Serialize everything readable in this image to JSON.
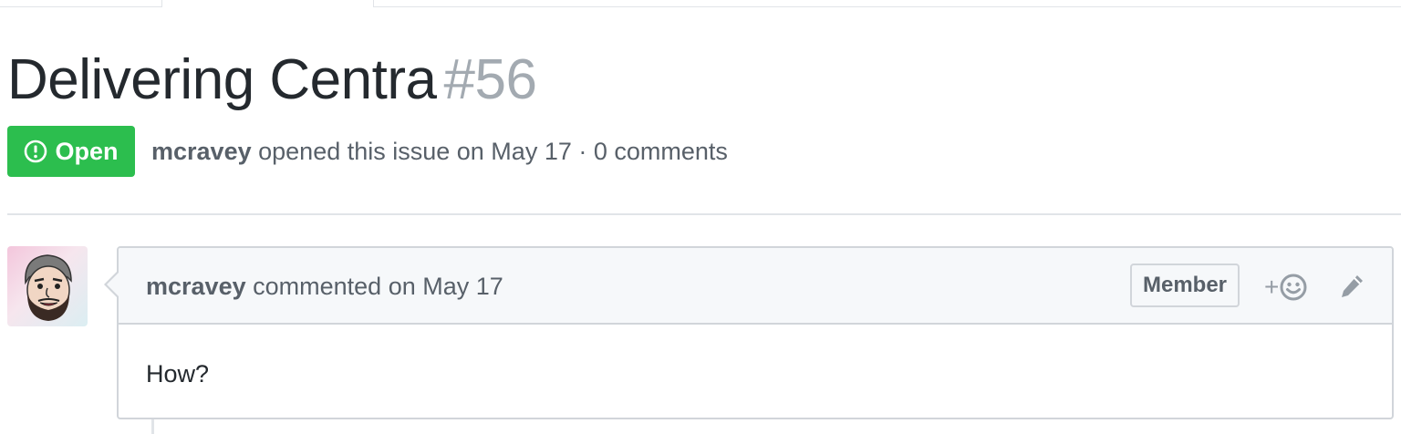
{
  "issue": {
    "title": "Delivering Centra",
    "number": "#56",
    "state_label": "Open",
    "state_icon": "issue-opened-icon",
    "author": "mcravey",
    "meta_text": "opened this issue on May 17 · 0 comments"
  },
  "comment": {
    "author": "mcravey",
    "action_text": "commented on May 17",
    "author_association": "Member",
    "reaction_label": "+",
    "reaction_icon": "smiley-icon",
    "edit_icon": "pencil-icon",
    "body": "How?"
  },
  "colors": {
    "open_green": "#2cbe4e",
    "muted_text": "#586069",
    "number_gray": "#a3aab1",
    "border": "#d1d5da"
  }
}
